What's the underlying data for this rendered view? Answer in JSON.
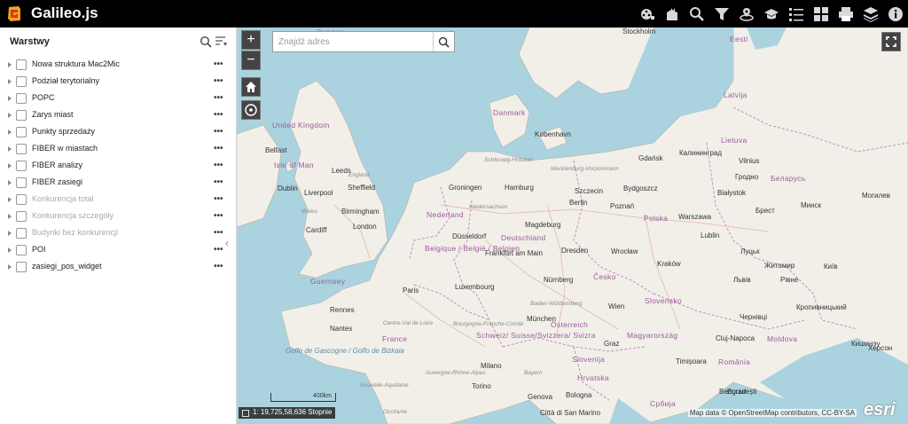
{
  "app": {
    "title": "Galileo.js"
  },
  "toolbar": {
    "icons": [
      "film-reel-icon",
      "bookmark-map-icon",
      "search-icon",
      "filter-icon",
      "layers-stack-icon",
      "graduation-cap-icon",
      "list-icon",
      "grid-icon",
      "print-icon",
      "basemap-icon",
      "info-icon"
    ]
  },
  "layers_panel": {
    "title": "Warstwy",
    "items": [
      {
        "label": "Nowa struktura Mac2Mic",
        "enabled": true
      },
      {
        "label": "Podział terytorialny",
        "enabled": true
      },
      {
        "label": "POPC",
        "enabled": true
      },
      {
        "label": "Zarys miast",
        "enabled": true
      },
      {
        "label": "Punkty sprzedaży",
        "enabled": true
      },
      {
        "label": "FIBER w miastach",
        "enabled": true
      },
      {
        "label": "FIBER analizy",
        "enabled": true
      },
      {
        "label": "FIBER zasiegi",
        "enabled": true
      },
      {
        "label": "Konkurencja total",
        "enabled": false
      },
      {
        "label": "Konkurencja szczegóły",
        "enabled": false
      },
      {
        "label": "Budynki bez konkurencji",
        "enabled": false
      },
      {
        "label": "POI",
        "enabled": true
      },
      {
        "label": "zasiegi_pos_widget",
        "enabled": true
      }
    ],
    "more_label": "•••"
  },
  "map": {
    "search": {
      "placeholder": "Znajdź adres"
    },
    "zoom_in": "+",
    "zoom_out": "−",
    "scale_text": "400km",
    "scale_readout": "1: 19,725,58,636 Stopnie",
    "attribution": "Map data © OpenStreetMap contributors, CC-BY-SA",
    "esri": "esri",
    "labels": [
      {
        "text": "Stockholm",
        "cls": ""
      },
      {
        "text": "Eesti",
        "cls": "country"
      },
      {
        "text": "Latvija",
        "cls": "country"
      },
      {
        "text": "Lietuva",
        "cls": "country"
      },
      {
        "text": "Danmark",
        "cls": "country"
      },
      {
        "text": "København",
        "cls": ""
      },
      {
        "text": "United Kingdom",
        "cls": "country"
      },
      {
        "text": "Isle of Man",
        "cls": "country"
      },
      {
        "text": "Belfast",
        "cls": ""
      },
      {
        "text": "Leeds",
        "cls": ""
      },
      {
        "text": "Sheffield",
        "cls": ""
      },
      {
        "text": "Liverpool",
        "cls": ""
      },
      {
        "text": "Dublin",
        "cls": ""
      },
      {
        "text": "Birmingham",
        "cls": ""
      },
      {
        "text": "Cardiff",
        "cls": ""
      },
      {
        "text": "London",
        "cls": ""
      },
      {
        "text": "England",
        "cls": "region"
      },
      {
        "text": "Wales",
        "cls": "region"
      },
      {
        "text": "Groningen",
        "cls": ""
      },
      {
        "text": "Hamburg",
        "cls": ""
      },
      {
        "text": "Szczecin",
        "cls": ""
      },
      {
        "text": "Bydgoszcz",
        "cls": ""
      },
      {
        "text": "Gdańsk",
        "cls": ""
      },
      {
        "text": "Калининград",
        "cls": ""
      },
      {
        "text": "Vilnius",
        "cls": ""
      },
      {
        "text": "Гродно",
        "cls": ""
      },
      {
        "text": "Беларусь",
        "cls": "country"
      },
      {
        "text": "Białystok",
        "cls": ""
      },
      {
        "text": "Nederland",
        "cls": "country"
      },
      {
        "text": "Berlin",
        "cls": ""
      },
      {
        "text": "Poznań",
        "cls": ""
      },
      {
        "text": "Polska",
        "cls": "country"
      },
      {
        "text": "Warszawa",
        "cls": ""
      },
      {
        "text": "Magdeburg",
        "cls": ""
      },
      {
        "text": "Düsseldorf",
        "cls": ""
      },
      {
        "text": "Deutschland",
        "cls": "country"
      },
      {
        "text": "Lublin",
        "cls": ""
      },
      {
        "text": "Belgique / België / Belgien",
        "cls": "country"
      },
      {
        "text": "Frankfurt am Main",
        "cls": ""
      },
      {
        "text": "Dresden",
        "cls": ""
      },
      {
        "text": "Wrocław",
        "cls": ""
      },
      {
        "text": "Kraków",
        "cls": ""
      },
      {
        "text": "Luxembourg",
        "cls": ""
      },
      {
        "text": "Nürnberg",
        "cls": ""
      },
      {
        "text": "Česko",
        "cls": "country"
      },
      {
        "text": "Paris",
        "cls": ""
      },
      {
        "text": "Guernsey",
        "cls": "country"
      },
      {
        "text": "Rennes",
        "cls": ""
      },
      {
        "text": "Nantes",
        "cls": ""
      },
      {
        "text": "France",
        "cls": "country"
      },
      {
        "text": "Wien",
        "cls": ""
      },
      {
        "text": "München",
        "cls": ""
      },
      {
        "text": "Österreich",
        "cls": "country"
      },
      {
        "text": "Slovensko",
        "cls": "country"
      },
      {
        "text": "Magyarország",
        "cls": "country"
      },
      {
        "text": "Schweiz/ Suisse/Svizzera/ Svizra",
        "cls": "country"
      },
      {
        "text": "Graz",
        "cls": ""
      },
      {
        "text": "Slovenija",
        "cls": "country"
      },
      {
        "text": "Hrvatska",
        "cls": "country"
      },
      {
        "text": "Milano",
        "cls": ""
      },
      {
        "text": "Torino",
        "cls": ""
      },
      {
        "text": "Genova",
        "cls": ""
      },
      {
        "text": "Bologna",
        "cls": ""
      },
      {
        "text": "Città di San Marino",
        "cls": ""
      },
      {
        "text": "Србија",
        "cls": "country"
      },
      {
        "text": "Timișoara",
        "cls": ""
      },
      {
        "text": "România",
        "cls": "country"
      },
      {
        "text": "Cluj-Napoca",
        "cls": ""
      },
      {
        "text": "București",
        "cls": ""
      },
      {
        "text": "Beograd",
        "cls": ""
      },
      {
        "text": "Moldova",
        "cls": "country"
      },
      {
        "text": "Кишинэу",
        "cls": ""
      },
      {
        "text": "Херсон",
        "cls": ""
      },
      {
        "text": "Житомир",
        "cls": ""
      },
      {
        "text": "Київ",
        "cls": ""
      },
      {
        "text": "Львів",
        "cls": ""
      },
      {
        "text": "Луцьк",
        "cls": ""
      },
      {
        "text": "Рівне",
        "cls": ""
      },
      {
        "text": "Чернівці",
        "cls": ""
      },
      {
        "text": "Кропивницький",
        "cls": ""
      },
      {
        "text": "Могилев",
        "cls": ""
      },
      {
        "text": "Минск",
        "cls": ""
      },
      {
        "text": "Брест",
        "cls": ""
      },
      {
        "text": "Golfe de Gascogne / Golfo de Bizkaia",
        "cls": "water"
      },
      {
        "text": "Occitanie",
        "cls": "region"
      },
      {
        "text": "Nouvelle-Aquitaine",
        "cls": "region"
      },
      {
        "text": "Centre-Val de Loire",
        "cls": "region"
      },
      {
        "text": "Auvergne-Rhône-Alpes",
        "cls": "region"
      },
      {
        "text": "Bourgogne-Franche-Comté",
        "cls": "region"
      },
      {
        "text": "Baden-Württemberg",
        "cls": "region"
      },
      {
        "text": "Bayern",
        "cls": "region"
      },
      {
        "text": "Niedersachsen",
        "cls": "region"
      },
      {
        "text": "Schleswig-Holstein",
        "cls": "region"
      },
      {
        "text": "Mecklenburg-Vorpommern",
        "cls": "region"
      },
      {
        "text": "Sverige",
        "cls": "country"
      }
    ]
  }
}
